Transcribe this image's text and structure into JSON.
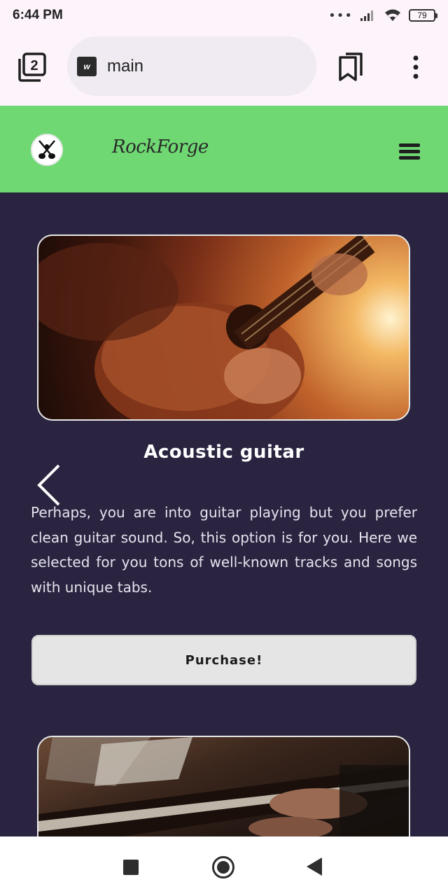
{
  "status_bar": {
    "time": "6:44 PM",
    "signal_dots": "•••",
    "battery_level": "79",
    "icons": [
      "signal-icon",
      "wifi-icon",
      "battery-icon"
    ]
  },
  "browser": {
    "tab_count": "2",
    "url_text": "main",
    "favicon_text": "w",
    "icons": [
      "tabs-icon",
      "bookmark-icon",
      "more-options-icon"
    ]
  },
  "site": {
    "brand": "RockForge",
    "header_color": "#6fd873",
    "icons": [
      "guitar-logo-icon",
      "hamburger-menu-icon"
    ]
  },
  "card": {
    "title": "Acoustic guitar",
    "description": "Perhaps, you are into guitar playing but you prefer clean guitar sound. So, this option is for you. Here we selected for you tons of well-known tracks and songs with unique tabs.",
    "button_label": "Purchase!",
    "image": "acoustic-guitar-photo",
    "next_image": "piano-photo"
  },
  "colors": {
    "background": "#2a2440",
    "accent_green": "#6fd873",
    "button_bg": "#e5e5e5"
  }
}
